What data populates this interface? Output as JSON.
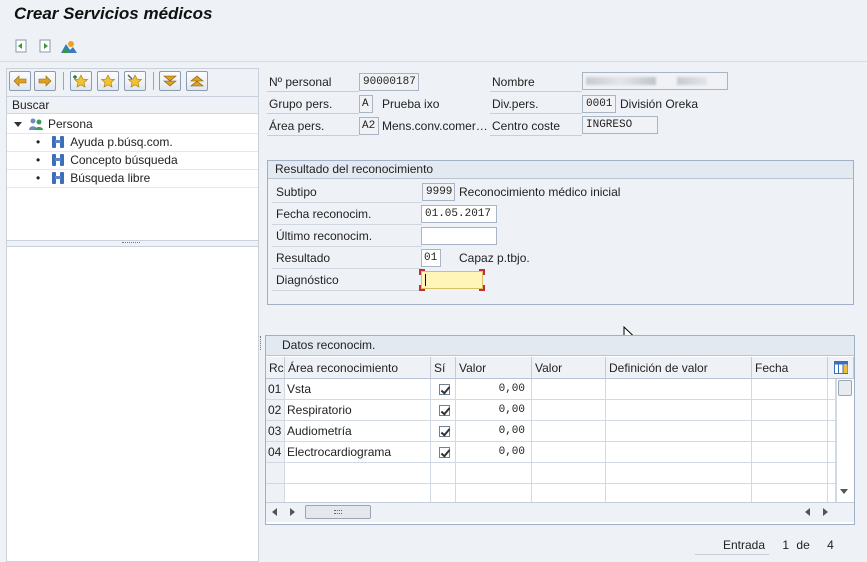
{
  "title": "Crear Servicios médicos",
  "app_toolbar": {
    "icons": [
      "previous-record-icon",
      "next-record-icon",
      "landscape-icon"
    ]
  },
  "left_panel": {
    "toolbar_icons": [
      "back-arrow-icon",
      "forward-arrow-icon",
      "add-favorite-icon",
      "favorite-star-icon",
      "change-favorite-icon",
      "expand-down-icon",
      "collapse-up-icon"
    ],
    "section_label": "Buscar",
    "tree": {
      "root": "Persona",
      "items": [
        "Ayuda p.búsq.com.",
        "Concepto búsqueda",
        "Búsqueda libre"
      ]
    }
  },
  "header": {
    "personal_label": "Nº personal",
    "personal_value": "90000187",
    "nombre_label": "Nombre",
    "grupo_label": "Grupo pers.",
    "grupo_code": "A",
    "grupo_text": "Prueba ixo",
    "div_label": "Div.pers.",
    "div_code": "0001",
    "div_text": "División Oreka",
    "area_label": "Área pers.",
    "area_code": "A2",
    "area_text": "Mens.conv.comer…",
    "centro_label": "Centro coste",
    "centro_value": "INGRESO"
  },
  "result_group": {
    "title": "Resultado del reconocimiento",
    "subtipo_label": "Subtipo",
    "subtipo_code": "9999",
    "subtipo_text": "Reconocimiento médico inicial",
    "fecha_label": "Fecha reconocim.",
    "fecha_value": "01.05.2017",
    "ultimo_label": "Último reconocim.",
    "ultimo_value": "",
    "resultado_label": "Resultado",
    "resultado_code": "01",
    "resultado_text": "Capaz p.tbjo.",
    "diagnostico_label": "Diagnóstico",
    "diagnostico_value": ""
  },
  "table": {
    "title": "Datos reconocim.",
    "columns": [
      "Rc",
      "Área reconocimiento",
      "Sí",
      "Valor",
      "Valor",
      "Definición de valor",
      "Fecha"
    ],
    "rows": [
      {
        "rc": "01",
        "area": "Vsta",
        "si": true,
        "valor": "0,00"
      },
      {
        "rc": "02",
        "area": "Respiratorio",
        "si": true,
        "valor": "0,00"
      },
      {
        "rc": "03",
        "area": "Audiometría",
        "si": true,
        "valor": "0,00"
      },
      {
        "rc": "04",
        "area": "Electrocardiograma",
        "si": true,
        "valor": "0,00"
      }
    ]
  },
  "pagination": {
    "label": "Entrada",
    "current": "1",
    "of_label": "de",
    "total": "4"
  },
  "colors": {
    "highlight_field": "#fff5b8",
    "highlight_border": "#c0303a",
    "accent": "#3b6fb6"
  }
}
